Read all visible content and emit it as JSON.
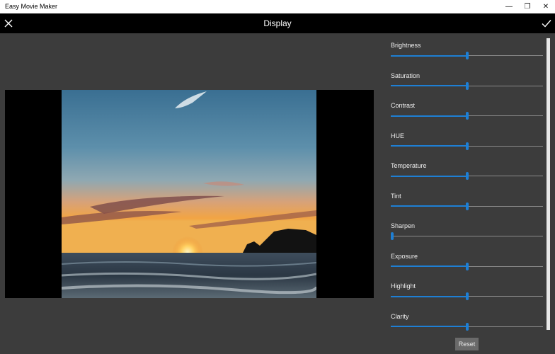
{
  "window": {
    "title": "Easy Movie Maker",
    "controls": {
      "minimize": "—",
      "restore": "❐",
      "close": "✕"
    }
  },
  "header": {
    "title": "Display",
    "close_icon": "close-icon",
    "confirm_icon": "checkmark-icon"
  },
  "colors": {
    "accent": "#1e7fd4",
    "background": "#3c3c3c",
    "header": "#000000"
  },
  "adjustments": [
    {
      "label": "Brightness",
      "value": 0.5
    },
    {
      "label": "Saturation",
      "value": 0.5
    },
    {
      "label": "Contrast",
      "value": 0.5
    },
    {
      "label": "HUE",
      "value": 0.5
    },
    {
      "label": "Temperature",
      "value": 0.5
    },
    {
      "label": "Tint",
      "value": 0.5
    },
    {
      "label": "Sharpen",
      "value": 0.0
    },
    {
      "label": "Exposure",
      "value": 0.5
    },
    {
      "label": "Highlight",
      "value": 0.5
    },
    {
      "label": "Clarity",
      "value": 0.5
    }
  ],
  "reset_label": "Reset"
}
